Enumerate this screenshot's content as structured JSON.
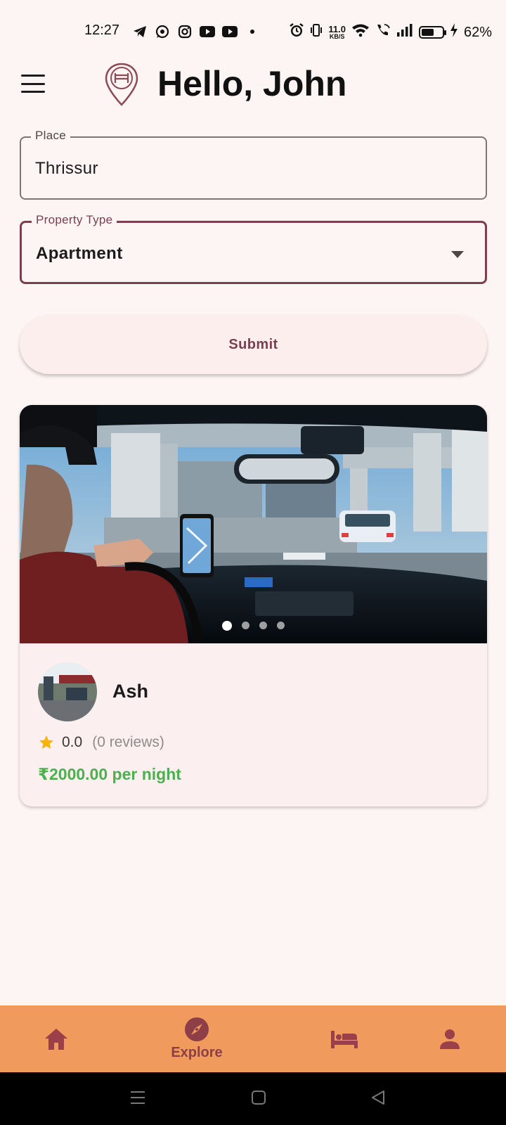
{
  "status_bar": {
    "time": "12:27",
    "net_speed_value": "11.0",
    "net_speed_unit": "KB/S",
    "battery_percent": "62%",
    "battery_level": 0.62
  },
  "header": {
    "title": "Hello, John"
  },
  "form": {
    "place": {
      "label": "Place",
      "value": "Thrissur"
    },
    "property_type": {
      "label": "Property Type",
      "value": "Apartment"
    },
    "submit_label": "Submit"
  },
  "listing": {
    "host_name": "Ash",
    "rating": "0.0",
    "reviews": "(0 reviews)",
    "price": "₹2000.00 per night",
    "carousel_count": 4,
    "carousel_active": 0
  },
  "bottom_nav": {
    "items": [
      {
        "icon": "home-icon",
        "label": ""
      },
      {
        "icon": "explore-icon",
        "label": "Explore"
      },
      {
        "icon": "bed-icon",
        "label": ""
      },
      {
        "icon": "person-icon",
        "label": ""
      }
    ],
    "active_index": 1
  },
  "colors": {
    "accent": "#7b3f52",
    "nav_background": "#f19a5d",
    "price": "#4caf50",
    "star": "#f7b500"
  }
}
